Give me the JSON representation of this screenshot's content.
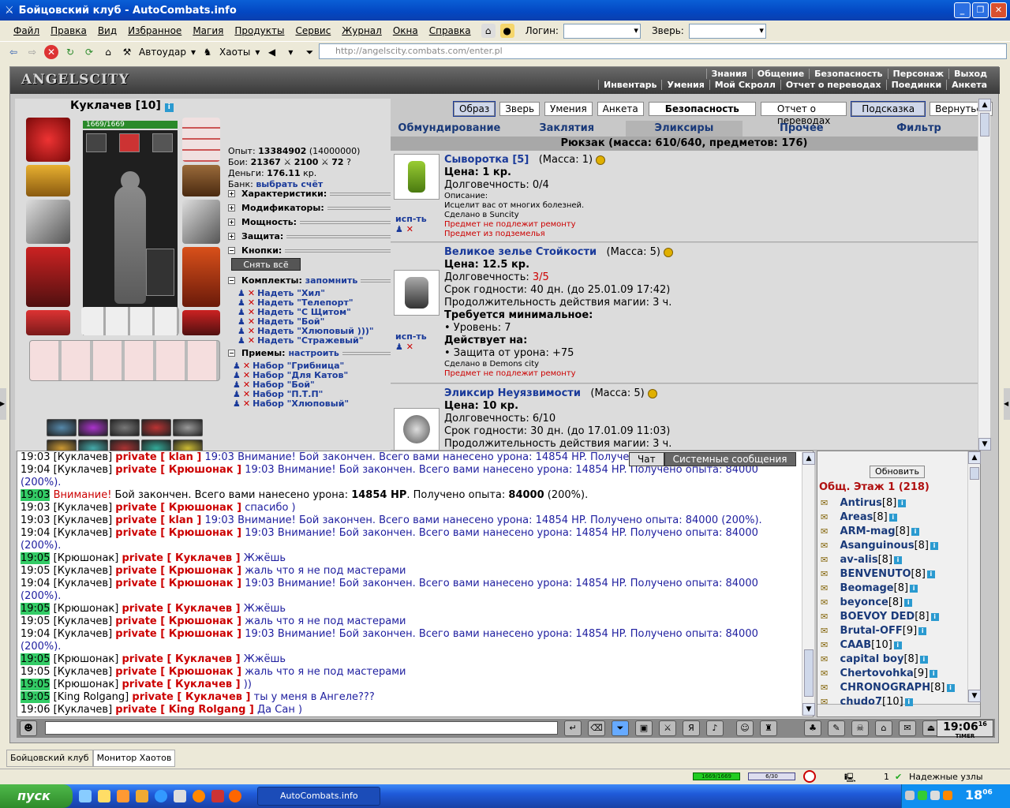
{
  "window": {
    "title": "Бойцовский клуб - AutoCombats.info"
  },
  "menu": {
    "items": [
      "Файл",
      "Правка",
      "Вид",
      "Избранное",
      "Магия",
      "Продукты",
      "Сервис",
      "Журнал",
      "Окна",
      "Справка"
    ],
    "login_label": "Логин:",
    "beast_label": "Зверь:"
  },
  "toolbar": {
    "autoudar": "Автоудар",
    "haots": "Хаоты",
    "address": "http://angelscity.combats.com/enter.pl"
  },
  "game": {
    "logo": "ANGELSCITY",
    "nav_top": [
      "Знания",
      "Общение",
      "Безопасность",
      "Персонаж",
      "Выход"
    ],
    "nav_bottom": [
      "Инвентарь",
      "Умения",
      "Мой Скролл",
      "Отчет о переводах",
      "Поединки",
      "Анкета"
    ],
    "character": {
      "name": "Куклачев [10]",
      "hp": "1669/1669"
    },
    "stats": {
      "exp_label": "Опыт:",
      "exp": "13384902",
      "exp_next": "(14000000)",
      "fights_label": "Бои:",
      "wins": "21367",
      "losses": "2100",
      "draws": "72",
      "money_label": "Деньги:",
      "money": "176.11",
      "money_unit": "кр.",
      "bank_label": "Банк:",
      "bank_link": "выбрать счёт"
    },
    "sections": [
      "Характеристики:",
      "Модификаторы:",
      "Мощность:",
      "Защита:",
      "Кнопки:"
    ],
    "unequip_all": "Снять всё",
    "sets_label": "Комплекты:",
    "sets_remember": "запомнить",
    "sets": [
      "Надеть \"Хил\"",
      "Надеть \"Телепорт\"",
      "Надеть \"С Щитом\"",
      "Надеть \"Бой\"",
      "Надеть \"Хлюповый )))\"",
      "Надеть \"Стражевый\""
    ],
    "tricks_label": "Приемы:",
    "tricks_setup": "настроить",
    "tricks": [
      "Набор \"Грибница\"",
      "Набор \"Для Катов\"",
      "Набор \"Бой\"",
      "Набор \"П.Т.П\"",
      "Набор \"Хлюповый\""
    ],
    "top_tabs": [
      "Образ",
      "Зверь",
      "Умения",
      "Анкета",
      "Безопасность",
      "Отчет о переводах",
      "Подсказка",
      "Вернуться"
    ],
    "categories": [
      "Обмундирование",
      "Заклятия",
      "Эликсиры",
      "Прочее",
      "Фильтр"
    ],
    "backpack": "Рюкзак (масса: 610/640, предметов: 176)",
    "use_label": "исп-ть",
    "items": [
      {
        "name": "Сыворотка [5]",
        "mass": "(Масса: 1)",
        "price": "Цена: 1 кр.",
        "durability_label": "Долговечность: ",
        "durability": "0/4",
        "lines": [
          "Описание:",
          "Исцелит вас от многих болезней.",
          "Сделано в Suncity"
        ],
        "red": [
          "Предмет не подлежит ремонту",
          "Предмет из подземелья"
        ]
      },
      {
        "name": "Великое зелье Стойкости",
        "mass": "(Масса: 5)",
        "price": "Цена: 12.5 кр.",
        "durability_label": "Долговечность: ",
        "durability": "3/5",
        "expiry": "Срок годности: 40 дн. (до 25.01.09 17:42)",
        "duration": "Продолжительность действия магии: 3 ч.",
        "req_head": "Требуется минимальное:",
        "req": "• Уровень: 7",
        "acts_head": "Действует на:",
        "acts": "• Защита от урона: +75",
        "made": "Сделано в Demons city",
        "red": "Предмет не подлежит ремонту"
      },
      {
        "name": "Эликсир Неуязвимости",
        "mass": "(Масса: 5)",
        "price": "Цена: 10 кр.",
        "durability_label": "Долговечность: ",
        "durability": "6/10",
        "expiry": "Срок годности: 30 дн. (до 17.01.09 11:03)",
        "duration": "Продолжительность действия магии: 3 ч."
      }
    ]
  },
  "chat": {
    "tabs": [
      "Чат",
      "Системные сообщения"
    ],
    "lines": [
      {
        "time": "19:03",
        "g": false,
        "nick": "Куклачев",
        "to": "private [ klan ]",
        "msg": "19:03 Внимание! Бой закончен. Всего вами нанесено урона: 14854 HP. Получено опыта: 84000 (200%)."
      },
      {
        "time": "19:04",
        "g": false,
        "nick": "Куклачев",
        "to": "private [ Крюшонак ]",
        "msg": "19:03 Внимание! Бой закончен. Всего вами нанесено урона: 14854 HP. Получено опыта: 84000"
      },
      {
        "cont": "(200%)."
      },
      {
        "time": "19:03",
        "g": true,
        "sys": "Внимание!",
        "sysmsg": " Бой закончен. Всего вами нанесено урона: ",
        "hp": "14854 HP",
        "sysmsg2": ". Получено опыта: ",
        "xp": "84000",
        "sysmsg3": " (200%)."
      },
      {
        "time": "19:03",
        "g": false,
        "nick": "Куклачев",
        "to": "private [ Крюшонак ]",
        "msg": "спасибо )"
      },
      {
        "time": "19:03",
        "g": false,
        "nick": "Куклачев",
        "to": "private [ klan ]",
        "msg": "19:03 Внимание! Бой закончен. Всего вами нанесено урона: 14854 HP. Получено опыта: 84000 (200%)."
      },
      {
        "time": "19:04",
        "g": false,
        "nick": "Куклачев",
        "to": "private [ Крюшонак ]",
        "msg": "19:03 Внимание! Бой закончен. Всего вами нанесено урона: 14854 HP. Получено опыта: 84000"
      },
      {
        "cont": "(200%)."
      },
      {
        "time": "19:05",
        "g": true,
        "nick": "Крюшонак",
        "to": "private [ Куклачев ]",
        "msg": "Жжёшь"
      },
      {
        "time": "19:05",
        "g": false,
        "nick": "Куклачев",
        "to": "private [ Крюшонак ]",
        "msg": "жаль что я не под мастерами"
      },
      {
        "time": "19:04",
        "g": false,
        "nick": "Куклачев",
        "to": "private [ Крюшонак ]",
        "msg": "19:03 Внимание! Бой закончен. Всего вами нанесено урона: 14854 HP. Получено опыта: 84000"
      },
      {
        "cont": "(200%)."
      },
      {
        "time": "19:05",
        "g": true,
        "nick": "Крюшонак",
        "to": "private [ Куклачев ]",
        "msg": "Жжёшь"
      },
      {
        "time": "19:05",
        "g": false,
        "nick": "Куклачев",
        "to": "private [ Крюшонак ]",
        "msg": "жаль что я не под мастерами"
      },
      {
        "time": "19:04",
        "g": false,
        "nick": "Куклачев",
        "to": "private [ Крюшонак ]",
        "msg": "19:03 Внимание! Бой закончен. Всего вами нанесено урона: 14854 HP. Получено опыта: 84000"
      },
      {
        "cont": "(200%)."
      },
      {
        "time": "19:05",
        "g": true,
        "nick": "Крюшонак",
        "to": "private [ Куклачев ]",
        "msg": "Жжёшь"
      },
      {
        "time": "19:05",
        "g": false,
        "nick": "Куклачев",
        "to": "private [ Крюшонак ]",
        "msg": "жаль что я не под мастерами"
      },
      {
        "time": "19:05",
        "g": true,
        "nick": "Крюшонак",
        "to": "private [ Куклачев ]",
        "msg": "))"
      },
      {
        "time": "19:05",
        "g": true,
        "nick": "King Rolgang",
        "to": "private [ Куклачев ]",
        "msg": "ты у меня в Ангеле???"
      },
      {
        "time": "19:06",
        "g": false,
        "nick": "Куклачев",
        "to": "private [ King Rolgang ]",
        "msg": "Да Сан )"
      }
    ]
  },
  "online": {
    "refresh": "Обновить",
    "header": "Общ. Этаж 1 (218)",
    "players": [
      {
        "name": "Antirus",
        "lvl": "[8]"
      },
      {
        "name": "Areas",
        "lvl": "[8]"
      },
      {
        "name": "ARM-mag",
        "lvl": "[8]"
      },
      {
        "name": "Asanguinous",
        "lvl": "[8]"
      },
      {
        "name": "av-alis",
        "lvl": "[8]"
      },
      {
        "name": "BENVENUTO",
        "lvl": "[8]"
      },
      {
        "name": "Beomage",
        "lvl": "[8]"
      },
      {
        "name": "beyonce",
        "lvl": "[8]"
      },
      {
        "name": "BOEVOY DED",
        "lvl": "[8]"
      },
      {
        "name": "Brutal-OFF",
        "lvl": "[9]"
      },
      {
        "name": "CAAB",
        "lvl": "[10]"
      },
      {
        "name": "capital boy",
        "lvl": "[8]"
      },
      {
        "name": "Chertovohka",
        "lvl": "[9]"
      },
      {
        "name": "CHRONOGRAPH",
        "lvl": "[8]"
      },
      {
        "name": "chudo7",
        "lvl": "[10]"
      }
    ]
  },
  "clock": {
    "time": "19:06",
    "sec": "16",
    "timer": "TIMER"
  },
  "bottom_tabs": [
    "Бойцовский клуб",
    "Монитор Хаотов"
  ],
  "status": {
    "hp": "1669/1669",
    "mp": "6/30",
    "count": "1",
    "nodes": "Надежные узлы"
  },
  "taskbar": {
    "start": "пуск",
    "item": "AutoCombats.info",
    "time": "18",
    "time_sup": "06"
  }
}
